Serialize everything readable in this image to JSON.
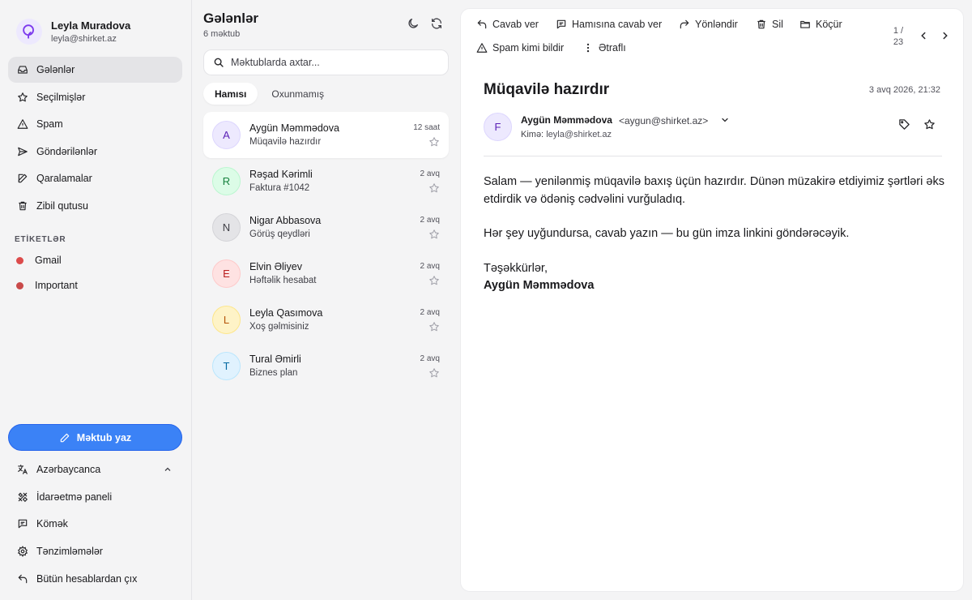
{
  "profile": {
    "name": "Leyla Muradova",
    "email": "leyla@shirket.az"
  },
  "nav": [
    {
      "label": "Gələnlər",
      "icon": "inbox-icon",
      "active": true
    },
    {
      "label": "Seçilmişlər",
      "icon": "star-icon"
    },
    {
      "label": "Spam",
      "icon": "alert-triangle-icon"
    },
    {
      "label": "Göndərilənlər",
      "icon": "send-icon"
    },
    {
      "label": "Qaralamalar",
      "icon": "pencil-icon"
    },
    {
      "label": "Zibil qutusu",
      "icon": "trash-icon"
    }
  ],
  "labels": {
    "title": "ETİKETLƏR",
    "items": [
      {
        "label": "Gmail",
        "color": "#dc4b4b"
      },
      {
        "label": "Important",
        "color": "#c94a4a"
      }
    ]
  },
  "compose_label": "Məktub yaz",
  "bottom_nav": [
    {
      "label": "Azərbaycanca",
      "icon": "language-icon"
    },
    {
      "label": "İdarəetmə paneli",
      "icon": "tools-icon"
    },
    {
      "label": "Kömək",
      "icon": "help-chat-icon"
    },
    {
      "label": "Tənzimləmələr",
      "icon": "settings-icon"
    },
    {
      "label": "Bütün hesablardan çıx",
      "icon": "logout-icon"
    }
  ],
  "list": {
    "title": "Gələnlər",
    "count": "6 məktub",
    "search_placeholder": "Məktublarda axtar...",
    "tabs": [
      "Hamısı",
      "Oxunmamış"
    ],
    "mails": [
      {
        "initial": "A",
        "from": "Aygün Məmmədova",
        "subject": "Müqavilə hazırdır",
        "time": "12 saat",
        "bg": "#ede9fe",
        "border": "#ddd6fe",
        "fg": "#5b21b6",
        "active": true
      },
      {
        "initial": "R",
        "from": "Rəşad Kərimli",
        "subject": "Faktura #1042",
        "time": "2 avq",
        "bg": "#dcfce7",
        "border": "#bbf7d0",
        "fg": "#15803d"
      },
      {
        "initial": "N",
        "from": "Nigar Abbasova",
        "subject": "Görüş qeydləri",
        "time": "2 avq",
        "bg": "#e4e4e7",
        "border": "#d4d4d8",
        "fg": "#3f3f46"
      },
      {
        "initial": "E",
        "from": "Elvin Əliyev",
        "subject": "Həftəlik hesabat",
        "time": "2 avq",
        "bg": "#fee2e2",
        "border": "#fecaca",
        "fg": "#b91c1c"
      },
      {
        "initial": "L",
        "from": "Leyla Qasımova",
        "subject": "Xoş gəlmisiniz",
        "time": "2 avq",
        "bg": "#fef3c7",
        "border": "#fde68a",
        "fg": "#b45309"
      },
      {
        "initial": "T",
        "from": "Tural Əmirli",
        "subject": "Biznes plan",
        "time": "2 avq",
        "bg": "#e0f2fe",
        "border": "#bae6fd",
        "fg": "#0369a1"
      }
    ]
  },
  "toolbar": {
    "reply": "Cavab ver",
    "reply_all": "Hamısına cavab ver",
    "forward": "Yönləndir",
    "delete": "Sil",
    "move": "Köçür",
    "spam": "Spam kimi bildir",
    "more": "Ətraflı",
    "pager": "1 / 23"
  },
  "message": {
    "subject": "Müqavilə hazırdır",
    "date": "3 avq 2026, 21:32",
    "sender_initial": "F",
    "sender_name": "Aygün Məmmədova",
    "sender_email": "<aygun@shirket.az>",
    "to_label": "Kimə:",
    "to": "leyla@shirket.az",
    "body_1": "Salam — yenilənmiş müqavilə baxış üçün hazırdır. Dünən müzakirə etdiyimiz şərtləri əks etdirdik və ödəniş cədvəlini vurğuladıq.",
    "body_2": "Hər şey uyğundursa, cavab yazın — bu gün imza linkini göndərəcəyik.",
    "body_3": "Təşəkkürlər,",
    "signature": "Aygün Məmmədova"
  }
}
